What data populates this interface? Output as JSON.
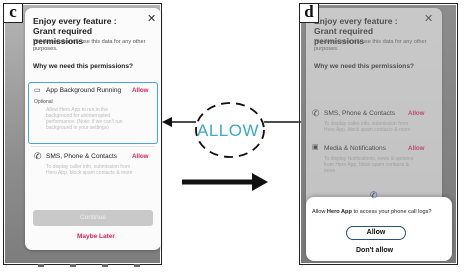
{
  "panels": {
    "left_letter": "c",
    "right_letter": "d"
  },
  "left_dialog": {
    "title": "Enjoy every feature : Grant required permissions",
    "subtitle": "We do not share & use this data for any other purposes.",
    "why": "Why we need this permissions?",
    "permissions": [
      {
        "icon": "app-background-icon",
        "name": "App Background Running",
        "allow": "Allow",
        "optional": "Optional",
        "description": "Allow Hero App to run in the background for uninterrupted performance. (Note: if we can't run background in your settings)"
      },
      {
        "icon": "phone-icon",
        "name": "SMS, Phone & Contacts",
        "allow": "Allow",
        "description": "To display caller info, submission from Hero App, block spam contacts & more"
      }
    ],
    "button_label": "Continue",
    "maybe_later": "Maybe Later"
  },
  "callout": {
    "label": "ALLOW"
  },
  "right_dialog": {
    "title": "Enjoy every feature : Grant required permissions",
    "subtitle": "We do not share & use this data for any other purposes.",
    "why": "Why we need this permissions?",
    "permissions": [
      {
        "icon": "phone-icon",
        "name": "SMS, Phone & Contacts",
        "allow": "Allow",
        "description": "To display caller info, submission from Hero App, block spam contacts & more"
      },
      {
        "icon": "media-icon",
        "name": "Media & Notifications",
        "allow": "Allow",
        "description": "To display Notifications, news & updates from Hero App, block spam contacts & more"
      }
    ]
  },
  "system_prompt": {
    "text_prefix": "Allow ",
    "app_name": "Hero App",
    "text_suffix": " to access your phone call logs?",
    "allow": "Allow",
    "deny": "Don't allow"
  },
  "colors": {
    "accent_pink": "#e0245e",
    "highlight_blue": "#4aa3df",
    "allow_text": "#3fa8c8",
    "button_outline": "#2c4e88"
  }
}
